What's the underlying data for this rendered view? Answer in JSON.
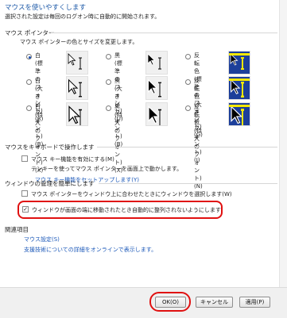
{
  "page": {
    "title": "マウスを使いやすくします",
    "subtitle": "選択された設定は毎回のログオン時に自動的に開始されます。"
  },
  "pointer_section": {
    "header": "マウス ポインター",
    "description": "マウス ポインターの色とサイズを変更します。",
    "options": [
      {
        "line1": "白 (標準のフ",
        "line2": "ォント)(R)",
        "selected": true,
        "scheme": "white",
        "size": "regular"
      },
      {
        "line1": "黒 (標準のフ",
        "line2": "ォント)(U)",
        "selected": false,
        "scheme": "black",
        "size": "regular"
      },
      {
        "line1": "反転色 (標準",
        "line2": "のフォント)",
        "line3": "(G)",
        "selected": false,
        "scheme": "inverted",
        "size": "regular"
      },
      {
        "line1": "白 (大きいフ",
        "line2": "ォント)(B)",
        "selected": false,
        "scheme": "white",
        "size": "large"
      },
      {
        "line1": "黒 (大きいフ",
        "line2": "ォント)(B)",
        "selected": false,
        "scheme": "black",
        "size": "large"
      },
      {
        "line1": "反転色 (大き",
        "line2": "いフォント)",
        "line3": "(I)",
        "selected": false,
        "scheme": "inverted",
        "size": "large"
      },
      {
        "line1": "白 (特大のフ",
        "line2": "ォント)(X)",
        "selected": false,
        "scheme": "white",
        "size": "xlarge"
      },
      {
        "line1": "黒 (特大のフ",
        "line2": "ォント)(X)",
        "selected": false,
        "scheme": "black",
        "size": "xlarge"
      },
      {
        "line1": "反転色 (特大",
        "line2": "のフォント)",
        "line3": "(N)",
        "selected": false,
        "scheme": "inverted",
        "size": "xlarge"
      }
    ]
  },
  "keyboard_section": {
    "header": "マウスをキーボードで操作します",
    "mouse_keys_label": "マウス キー機能を有効にする(M)",
    "mouse_keys_checked": false,
    "mouse_keys_desc": "テンキーを使ってマウス ポインターを画面上で動かします。",
    "setup_link": "マウス キー機能をセットアップします(Y)"
  },
  "window_section": {
    "header": "ウィンドウの管理を簡単にします",
    "hover_label": "マウス ポインターをウィンドウ上に合わせたときにウィンドウを選択します(W)",
    "hover_checked": false,
    "snap_label": "ウィンドウが画面の端に移動されたとき自動的に整列されないようにします",
    "snap_checked": true
  },
  "related": {
    "header": "関連項目",
    "link1": "マウス設定(S)",
    "link2": "支援技術についての詳細をオンラインで表示します。"
  },
  "buttons": {
    "ok": "OK(O)",
    "cancel": "キャンセル",
    "apply": "適用(P)"
  },
  "colors": {
    "highlight": "#e01010",
    "link": "#1a57b8",
    "inverted_bg": "#1d3f9a"
  }
}
